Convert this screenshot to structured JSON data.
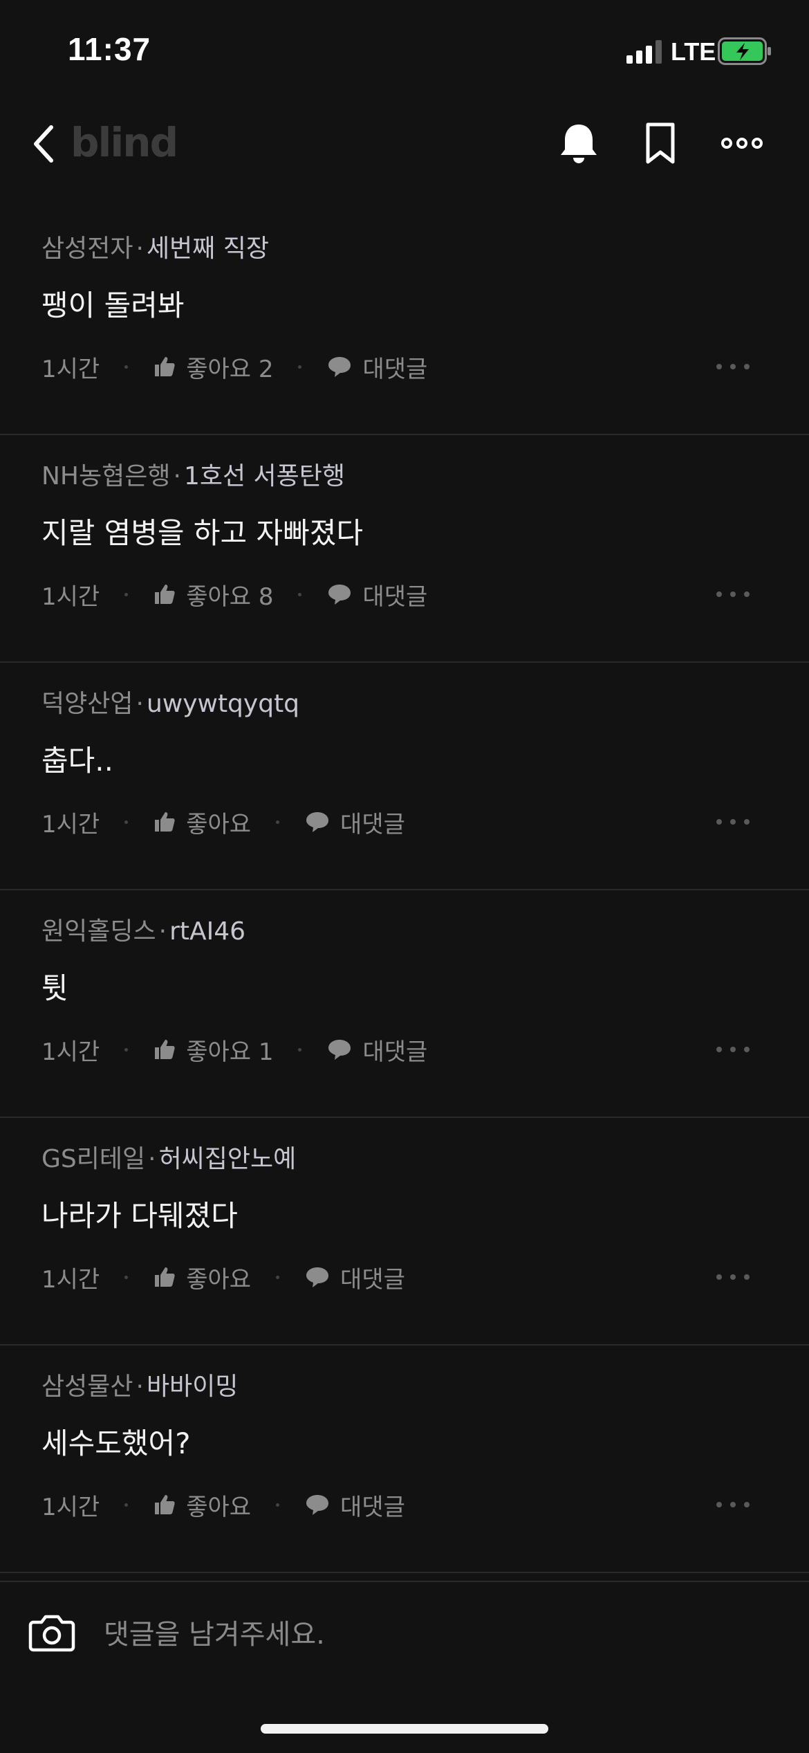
{
  "status": {
    "time": "11:37",
    "carrier": "LTE",
    "battery_color": "#35c759"
  },
  "header": {
    "logo": "blind",
    "icons": [
      "back-icon",
      "bell-icon",
      "bookmark-icon",
      "more-icon"
    ]
  },
  "comments": [
    {
      "company": "삼성전자",
      "nickname": "세번째 직장",
      "text": "팽이 돌려봐",
      "time": "1시간",
      "like_label": "좋아요 2",
      "reply_label": "대댓글"
    },
    {
      "company": "NH농협은행",
      "nickname": "1호선 서퐁탄행",
      "text": "지랄 염병을 하고 자빠졌다",
      "time": "1시간",
      "like_label": "좋아요 8",
      "reply_label": "대댓글"
    },
    {
      "company": "덕양산업",
      "nickname": "uwywtqyqtq",
      "text": "춥다..",
      "time": "1시간",
      "like_label": "좋아요",
      "reply_label": "대댓글"
    },
    {
      "company": "원익홀딩스",
      "nickname": "rtAI46",
      "text": "튓",
      "time": "1시간",
      "like_label": "좋아요 1",
      "reply_label": "대댓글"
    },
    {
      "company": "GS리테일",
      "nickname": "허씨집안노예",
      "text": "나라가 다뒈졌다",
      "time": "1시간",
      "like_label": "좋아요",
      "reply_label": "대댓글"
    },
    {
      "company": "삼성물산",
      "nickname": "바바이밍",
      "text": "세수도했어?",
      "time": "1시간",
      "like_label": "좋아요",
      "reply_label": "대댓글"
    }
  ],
  "composer": {
    "placeholder": "댓글을 남겨주세요."
  },
  "colors": {
    "background": "#121212",
    "divider": "#2a2a2a",
    "muted_text": "#8c8c8c"
  }
}
